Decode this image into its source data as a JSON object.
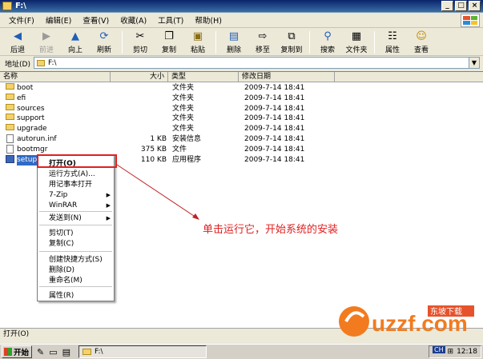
{
  "title": "F:\\",
  "window_buttons": [
    "_",
    "□",
    "×"
  ],
  "menu": [
    "文件(F)",
    "编辑(E)",
    "查看(V)",
    "收藏(A)",
    "工具(T)",
    "帮助(H)"
  ],
  "toolbar": {
    "back": "后退",
    "forward": "前进",
    "up": "向上",
    "refresh": "刷新",
    "cut": "剪切",
    "copy": "复制",
    "paste": "粘贴",
    "delete": "删除",
    "move_to": "移至",
    "copy_to": "复制到",
    "search": "搜索",
    "folders": "文件夹",
    "properties": "属性",
    "view": "查看"
  },
  "address": {
    "label": "地址(D)",
    "value": "F:\\"
  },
  "columns": {
    "name": "名称",
    "size": "大小",
    "type": "类型",
    "modified": "修改日期"
  },
  "files": [
    {
      "name": "boot",
      "size": "",
      "type": "文件夹",
      "modified": "2009-7-14 18:41",
      "kind": "folder"
    },
    {
      "name": "efi",
      "size": "",
      "type": "文件夹",
      "modified": "2009-7-14 18:41",
      "kind": "folder"
    },
    {
      "name": "sources",
      "size": "",
      "type": "文件夹",
      "modified": "2009-7-14 18:41",
      "kind": "folder"
    },
    {
      "name": "support",
      "size": "",
      "type": "文件夹",
      "modified": "2009-7-14 18:41",
      "kind": "folder"
    },
    {
      "name": "upgrade",
      "size": "",
      "type": "文件夹",
      "modified": "2009-7-14 18:41",
      "kind": "folder"
    },
    {
      "name": "autorun.inf",
      "size": "1 KB",
      "type": "安装信息",
      "modified": "2009-7-14 18:41",
      "kind": "file"
    },
    {
      "name": "bootmgr",
      "size": "375 KB",
      "type": "文件",
      "modified": "2009-7-14 18:41",
      "kind": "file"
    },
    {
      "name": "setup.exe",
      "size": "110 KB",
      "type": "应用程序",
      "modified": "2009-7-14 18:41",
      "kind": "exe"
    }
  ],
  "context_menu": [
    {
      "label": "打开(O)"
    },
    {
      "label": "运行方式(A)..."
    },
    {
      "label": "用记事本打开"
    },
    {
      "label": "7-Zip",
      "submenu": true
    },
    {
      "label": "WinRAR",
      "submenu": true
    },
    {
      "label": "发送到(N)",
      "submenu": true
    },
    {
      "label": "剪切(T)"
    },
    {
      "label": "复制(C)"
    },
    {
      "label": "创建快捷方式(S)"
    },
    {
      "label": "删除(D)"
    },
    {
      "label": "重命名(M)"
    },
    {
      "label": "属性(R)"
    }
  ],
  "annotation": "单击运行它，开始系统的安装",
  "status_text": "打开(O)",
  "taskbar": {
    "start": "开始",
    "task": "F:\\",
    "lang": "CH",
    "clock": "12:18"
  },
  "watermark": {
    "brand": "uzzf.com",
    "tag": "东坡下载"
  }
}
